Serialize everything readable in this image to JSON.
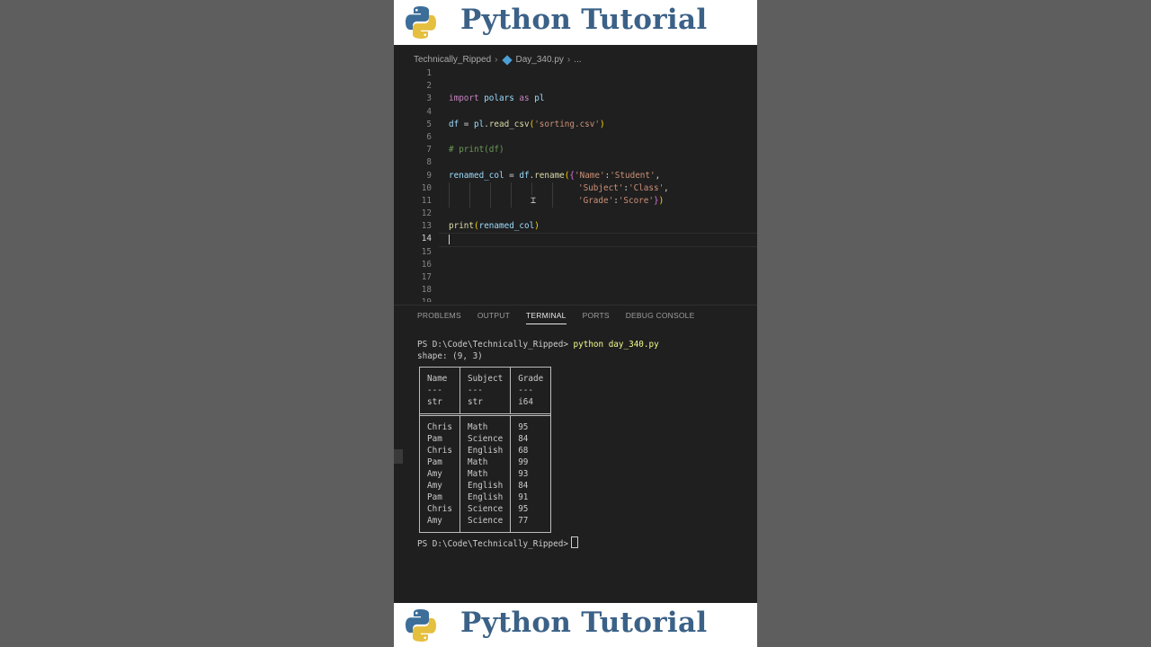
{
  "banner": {
    "title": "Python Tutorial"
  },
  "breadcrumb": {
    "folder": "Technically_Ripped",
    "file": "Day_340.py",
    "more": "..."
  },
  "code_lines": [
    {
      "n": "1"
    },
    {
      "n": "2"
    },
    {
      "n": "3"
    },
    {
      "n": "4"
    },
    {
      "n": "5"
    },
    {
      "n": "6"
    },
    {
      "n": "7"
    },
    {
      "n": "8"
    },
    {
      "n": "9"
    },
    {
      "n": "10"
    },
    {
      "n": "11"
    },
    {
      "n": "12"
    },
    {
      "n": "13"
    },
    {
      "n": "14"
    },
    {
      "n": "15"
    },
    {
      "n": "16"
    },
    {
      "n": "17"
    },
    {
      "n": "18"
    },
    {
      "n": "19"
    }
  ],
  "code": {
    "l3_kw": "import",
    "l3_mod": "polars",
    "l3_as": "as",
    "l3_alias": "pl",
    "l5_var": "df",
    "l5_eq": " = ",
    "l5_obj": "pl",
    "l5_fn": "read_csv",
    "l5_str": "'sorting.csv'",
    "l7_comment": "# print(df)",
    "l9_var": "renamed_col",
    "l9_eq": " = ",
    "l9_obj": "df",
    "l9_fn": "rename",
    "l9_k": "'Name'",
    "l9_v": "'Student'",
    "l10_k": "'Subject'",
    "l10_v": "'Class'",
    "l11_k": "'Grade'",
    "l11_v": "'Score'",
    "l13_fn": "print",
    "l13_arg": "renamed_col"
  },
  "panel_tabs": [
    "PROBLEMS",
    "OUTPUT",
    "TERMINAL",
    "PORTS",
    "DEBUG CONSOLE"
  ],
  "terminal": {
    "prompt": "PS D:\\Code\\Technically_Ripped>",
    "command": "python day_340.py",
    "shape": "shape: (9, 3)",
    "columns": [
      "Name",
      "Subject",
      "Grade"
    ],
    "dashes": [
      "---",
      "---",
      "---"
    ],
    "dtypes": [
      "str",
      "str",
      "i64"
    ],
    "rows": [
      [
        "Chris",
        "Math",
        "95"
      ],
      [
        "Pam",
        "Science",
        "84"
      ],
      [
        "Chris",
        "English",
        "68"
      ],
      [
        "Pam",
        "Math",
        "99"
      ],
      [
        "Amy",
        "Math",
        "93"
      ],
      [
        "Amy",
        "English",
        "84"
      ],
      [
        "Pam",
        "English",
        "91"
      ],
      [
        "Chris",
        "Science",
        "95"
      ],
      [
        "Amy",
        "Science",
        "77"
      ]
    ],
    "prompt2": "PS D:\\Code\\Technically_Ripped>"
  },
  "icons": {
    "logo": "python-logo-icon",
    "file": "python-file-icon",
    "chevron": "chevron-right-icon"
  }
}
